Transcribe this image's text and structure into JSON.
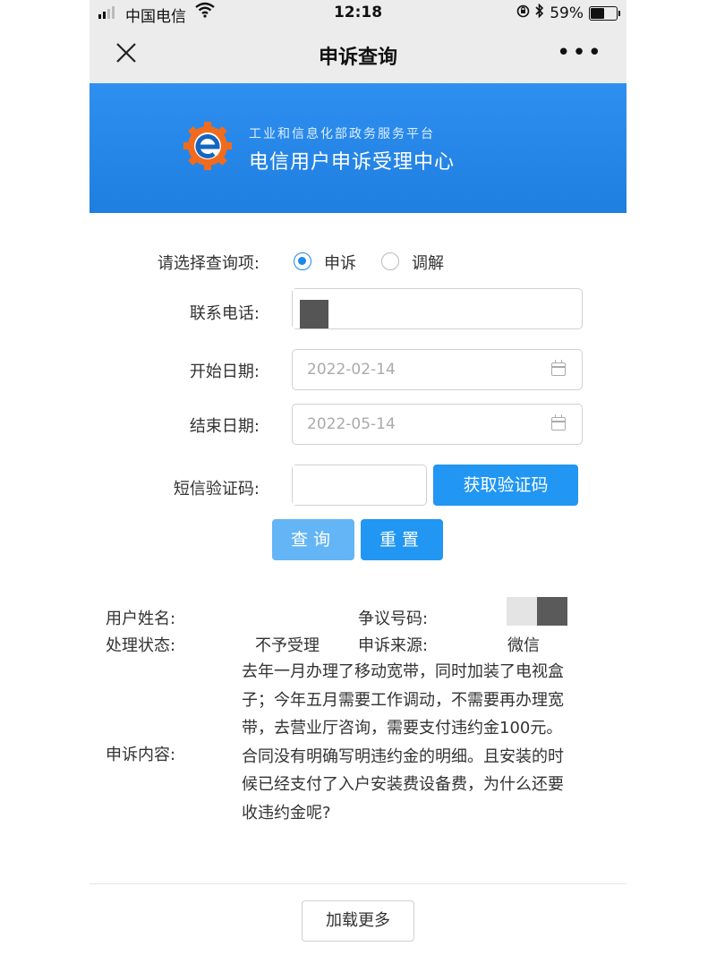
{
  "status_bar": {
    "carrier": "中国电信",
    "time": "12:18",
    "battery": "59%",
    "battery_level": 0.59
  },
  "nav": {
    "title": "申诉查询",
    "more": "•••"
  },
  "banner": {
    "subtitle": "工业和信息化部政务服务平台",
    "title": "电信用户申诉受理中心",
    "colors": {
      "background": "#1f7fe0",
      "logo_orange": "#f26b1d",
      "logo_blue": "#1565c0"
    }
  },
  "form": {
    "query_type_label": "请选择查询项:",
    "options": [
      {
        "label": "申诉",
        "selected": true
      },
      {
        "label": "调解",
        "selected": false
      }
    ],
    "phone_label": "联系电话:",
    "start_label": "开始日期:",
    "start_value": "2022-02-14",
    "end_label": "结束日期:",
    "end_value": "2022-05-14",
    "sms_label": "短信验证码:",
    "get_code_button": "获取验证码",
    "query_button": "查询",
    "reset_button": "重置"
  },
  "result": {
    "name_label": "用户姓名:",
    "dispute_number_label": "争议号码:",
    "status_label": "处理状态:",
    "status_value": "不予受理",
    "source_label": "申诉来源:",
    "source_value": "微信",
    "content_label": "申诉内容:",
    "content_value": "去年一月办理了移动宽带，同时加装了电视盒子；今年五月需要工作调动，不需要再办理宽带，去营业厅咨询，需要支付违约金100元。合同没有明确写明违约金的明细。且安装的时候已经支付了入户安装费设备费，为什么还要收违约金呢?"
  },
  "load_more": "加载更多",
  "accent_color": "#2196f3"
}
